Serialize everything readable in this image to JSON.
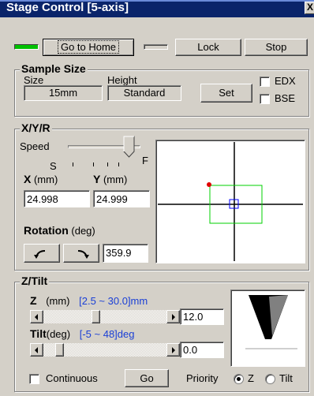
{
  "window": {
    "title": "Stage Control [5-axis]",
    "close_glyph": "X"
  },
  "top_bar": {
    "home_indicator_color": "#00c000",
    "home_button": "Go to Home",
    "lock_button": "Lock",
    "stop_button": "Stop"
  },
  "sample_size": {
    "title": "Sample Size",
    "size_label": "Size",
    "size_value": "15mm",
    "height_label": "Height",
    "height_value": "Standard",
    "set_button": "Set",
    "edx_label": "EDX",
    "bse_label": "BSE"
  },
  "xyr": {
    "title": "X/Y/R",
    "speed_label": "Speed",
    "slow_label": "S",
    "fast_label": "F",
    "x_label": "X",
    "y_label": "Y",
    "unit_mm": "(mm)",
    "x_value": "24.998",
    "y_value": "24.999",
    "rotation_label": "Rotation",
    "rotation_unit": "(deg)",
    "rotation_value": "359.9",
    "ccw_icon": "rotate-ccw-icon",
    "cw_icon": "rotate-cw-icon",
    "colors": {
      "frame": "#00d000",
      "cursor": "#0000ff",
      "marker": "#e00000"
    }
  },
  "ztilt": {
    "title": "Z/Tilt",
    "z_label": "Z",
    "z_unit": "(mm)",
    "z_range": "[2.5 ~ 30.0]mm",
    "z_value": "12.0",
    "tilt_label": "Tilt",
    "tilt_unit": "(deg)",
    "tilt_range": "[-5 ~ 48]deg",
    "tilt_value": "0.0",
    "continuous_label": "Continuous",
    "go_button": "Go",
    "priority_label": "Priority",
    "priority_z": "Z",
    "priority_tilt": "Tilt",
    "priority_selected": "Z"
  }
}
